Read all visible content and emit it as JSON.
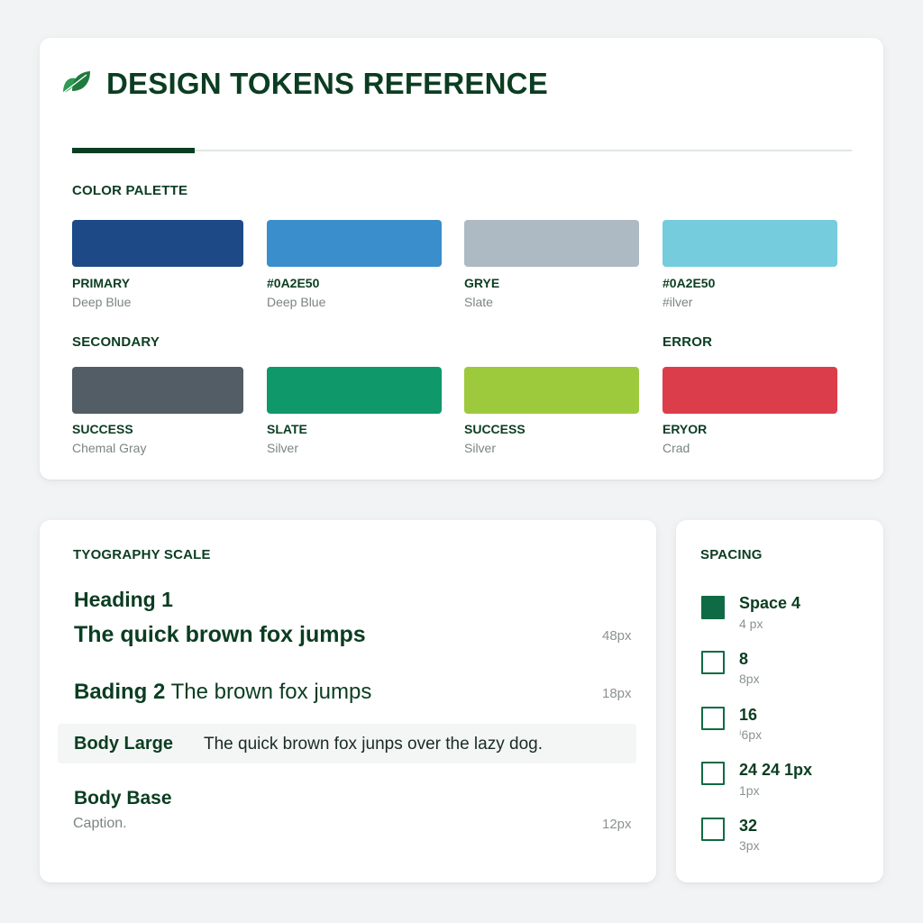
{
  "header": {
    "title": "DESIGN TOKENS REFERENCE",
    "icon": "leaf-icon"
  },
  "palette": {
    "label": "COLOR PALETTE",
    "row1": [
      {
        "name": "PRIMARY",
        "desc": "Deep Blue",
        "color": "#1d4a86"
      },
      {
        "name": "#0A2E50",
        "desc": "Deep Blue",
        "color": "#3a8ecb"
      },
      {
        "name": "GRYE",
        "desc": "Slate",
        "color": "#adbac3"
      },
      {
        "name": "#0A2E50",
        "desc": "#ilver",
        "color": "#74ccdd"
      }
    ],
    "mid_labels": {
      "left": "SECONDARY",
      "right": "ERROR"
    },
    "row2": [
      {
        "name": "SUCCESS",
        "desc": "Chemal Gray",
        "color": "#525d66"
      },
      {
        "name": "SLATE",
        "desc": "Silver",
        "color": "#0f986a"
      },
      {
        "name": "SUCCESS",
        "desc": "Silver",
        "color": "#9dca3c"
      },
      {
        "name": "ERYOR",
        "desc": "Crad",
        "color": "#dc3d4a"
      }
    ]
  },
  "typography": {
    "label": "TYOGRAPHY SCALE",
    "h1_label": "Heading 1",
    "h1_sample": "The quick brown fox jumps",
    "h1_size": "48px",
    "h2_label": "Bading 2",
    "h2_sample": "The brown fox jumps",
    "h2_size": "18px",
    "body_large_label": "Body Large",
    "body_large_sample": "The quick brown fox junps over the lazy dog.",
    "body_base_label": "Body Base",
    "caption": "Caption.",
    "caption_size": "12px"
  },
  "spacing": {
    "label": "SPACING",
    "items": [
      {
        "name": "Space 4",
        "sub": "4 px",
        "filled": true
      },
      {
        "name": "8",
        "sub": "8px",
        "filled": false
      },
      {
        "name": "16",
        "sub": "ⁱ6px",
        "filled": false
      },
      {
        "name": "24 24 1px",
        "sub": "1px",
        "filled": false
      },
      {
        "name": "32",
        "sub": "3px",
        "filled": false
      }
    ],
    "accent": "#0f6b43"
  }
}
